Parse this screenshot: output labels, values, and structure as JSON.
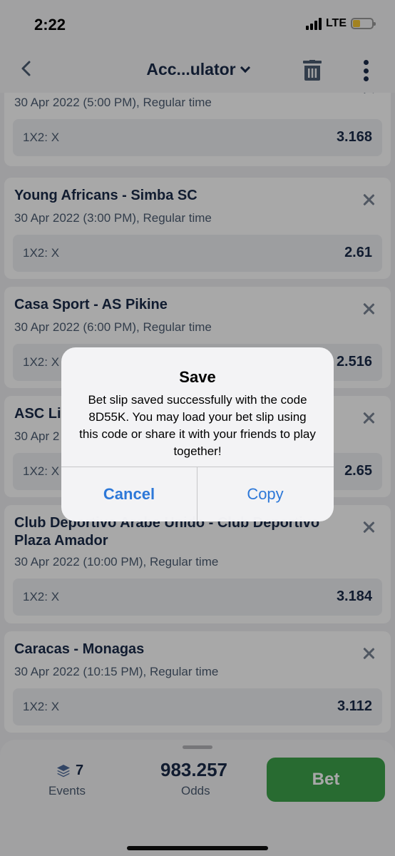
{
  "status_bar": {
    "time": "2:22",
    "network": "LTE"
  },
  "header": {
    "title": "Acc...ulator"
  },
  "bets": [
    {
      "date": "30 Apr 2022 (5:00 PM), Regular time",
      "selection": "1X2: X",
      "odds": "3.168"
    },
    {
      "match": "Young Africans - Simba SC",
      "date": "30 Apr 2022 (3:00 PM), Regular time",
      "selection": "1X2: X",
      "odds": "2.61"
    },
    {
      "match": "Casa Sport - AS Pikine",
      "date": "30 Apr 2022 (6:00 PM), Regular time",
      "selection": "1X2: X",
      "odds": "2.516"
    },
    {
      "match": "ASC Li",
      "date": "30 Apr 2",
      "selection": "1X2: X",
      "odds": "2.65"
    },
    {
      "match": "Club Deportivo Arabe Unido - Club Deportivo Plaza Amador",
      "date": "30 Apr 2022 (10:00 PM), Regular time",
      "selection": "1X2: X",
      "odds": "3.184"
    },
    {
      "match": "Caracas - Monagas",
      "date": "30 Apr 2022 (10:15 PM), Regular time",
      "selection": "1X2: X",
      "odds": "3.112"
    }
  ],
  "summary": {
    "events_count": "7",
    "events_label": "Events",
    "odds": "983.257",
    "odds_label": "Odds",
    "bet_label": "Bet"
  },
  "dialog": {
    "title": "Save",
    "message": "Bet slip saved successfully with the code 8D55K. You may load your bet slip using this code or share it with your friends to play together!",
    "cancel_label": "Cancel",
    "copy_label": "Copy"
  },
  "colors": {
    "accent_green": "#3ea34b",
    "ios_blue": "#2d78d8",
    "navy_text": "#1a2b4a"
  }
}
